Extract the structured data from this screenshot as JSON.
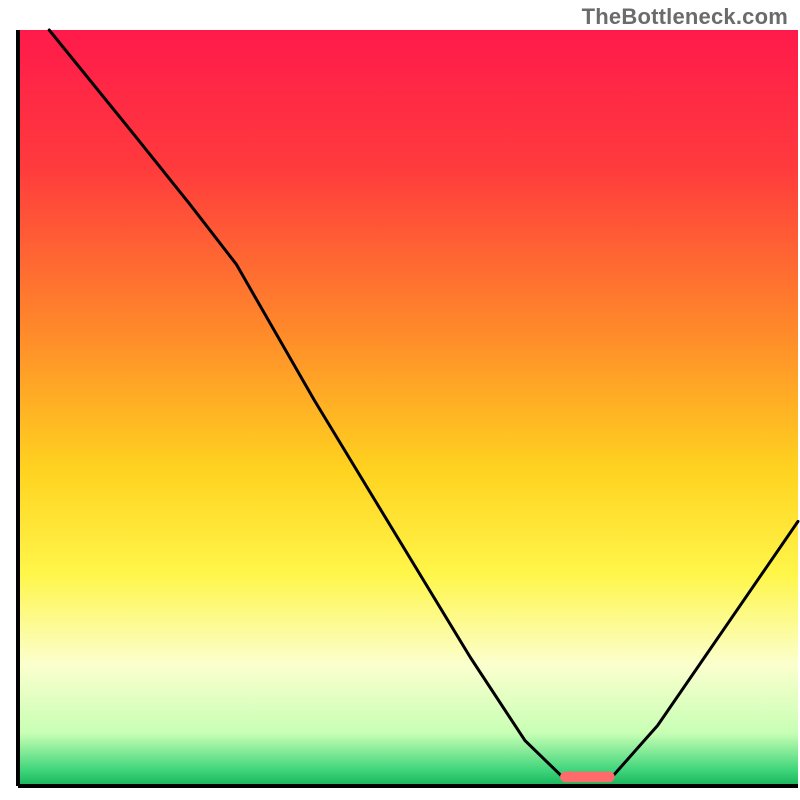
{
  "watermark": "TheBottleneck.com",
  "chart_data": {
    "type": "line",
    "title": "",
    "xlabel": "",
    "ylabel": "",
    "xlim": [
      0,
      100
    ],
    "ylim": [
      0,
      100
    ],
    "gradient_stops": [
      {
        "offset": 0.0,
        "color": "#ff1a4b"
      },
      {
        "offset": 0.18,
        "color": "#ff3a3d"
      },
      {
        "offset": 0.4,
        "color": "#ff8a2a"
      },
      {
        "offset": 0.58,
        "color": "#ffd21f"
      },
      {
        "offset": 0.72,
        "color": "#fff64a"
      },
      {
        "offset": 0.84,
        "color": "#fbffce"
      },
      {
        "offset": 0.93,
        "color": "#c8ffb5"
      },
      {
        "offset": 0.98,
        "color": "#3dd47a"
      },
      {
        "offset": 1.0,
        "color": "#17b35b"
      }
    ],
    "curve_points": [
      {
        "x": 4.0,
        "y": 100.0
      },
      {
        "x": 15.0,
        "y": 86.0
      },
      {
        "x": 22.0,
        "y": 77.0
      },
      {
        "x": 28.0,
        "y": 69.0
      },
      {
        "x": 38.0,
        "y": 51.0
      },
      {
        "x": 48.0,
        "y": 34.0
      },
      {
        "x": 58.0,
        "y": 17.0
      },
      {
        "x": 65.0,
        "y": 6.0
      },
      {
        "x": 70.0,
        "y": 1.0
      },
      {
        "x": 76.0,
        "y": 1.0
      },
      {
        "x": 82.0,
        "y": 8.0
      },
      {
        "x": 90.0,
        "y": 20.0
      },
      {
        "x": 100.0,
        "y": 35.0
      }
    ],
    "marker": {
      "x": 73.0,
      "y": 1.2,
      "width": 7.0,
      "height": 1.4,
      "color": "#ff6a6a"
    },
    "axis_color": "#000000"
  }
}
